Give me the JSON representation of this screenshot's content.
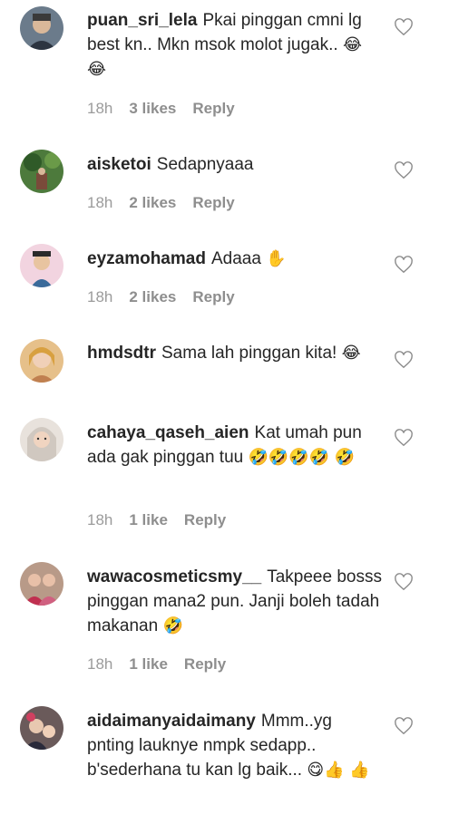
{
  "comments": [
    {
      "username": "puan_sri_lela",
      "text": "Pkai pinggan cmni lg best kn.. Mkn msok molot jugak..",
      "emoji": "😂 😂",
      "time": "18h",
      "likes": "3 likes",
      "reply": "Reply",
      "avatar_color": "#4a5a6a"
    },
    {
      "username": "aisketoi",
      "text": "Sedapnyaaa",
      "emoji": "",
      "time": "18h",
      "likes": "2 likes",
      "reply": "Reply",
      "avatar_color": "#3f6b3a"
    },
    {
      "username": "eyzamohamad",
      "text": "Adaaa",
      "emoji": "✋",
      "time": "18h",
      "likes": "2 likes",
      "reply": "Reply",
      "avatar_color": "#e8b4c8"
    },
    {
      "username": "hmdsdtr",
      "text": "Sama lah pinggan kita!",
      "emoji": "😂",
      "time": "",
      "likes": "",
      "reply": "",
      "avatar_color": "#e6c08a"
    },
    {
      "username": "cahaya_qaseh_aien",
      "text": "Kat umah pun ada gak pinggan tuu",
      "emoji": "🤣🤣🤣🤣 🤣",
      "time": "18h",
      "likes": "1 like",
      "reply": "Reply",
      "avatar_color": "#d8d0c8"
    },
    {
      "username": "wawacosmeticsmy__",
      "text": "Takpeee bosss pinggan mana2 pun. Janji boleh tadah makanan",
      "emoji": "🤣",
      "time": "18h",
      "likes": "1 like",
      "reply": "Reply",
      "avatar_color": "#c06070"
    },
    {
      "username": "aidaimanyaidaimany",
      "text": "Mmm..yg pnting lauknye nmpk sedapp.. b'sederhana tu kan lg baik...",
      "emoji": "😋👍 👍",
      "time": "",
      "likes": "",
      "reply": "",
      "avatar_color": "#5a4a4a"
    }
  ],
  "icons": {
    "like": "heart-outline-icon"
  },
  "colors": {
    "text": "#262626",
    "meta": "#8e8e8e",
    "heart": "#8e8e8e"
  }
}
